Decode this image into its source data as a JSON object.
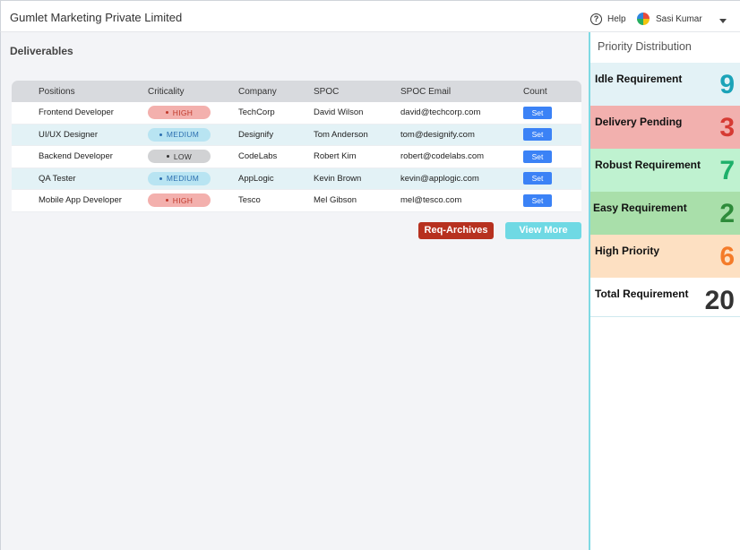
{
  "header": {
    "app_title": "Gumlet Marketing Private Limited",
    "help_label": "Help",
    "user_name": "Sasi Kumar"
  },
  "main": {
    "section_title": "Deliverables",
    "columns": [
      "Positions",
      "Criticality",
      "Company",
      "SPOC",
      "SPOC Email",
      "Count"
    ],
    "rows": [
      {
        "position": "Frontend Developer",
        "criticality": "HIGH",
        "company": "TechCorp",
        "spoc": "David Wilson",
        "email": "david@techcorp.com",
        "action": "Set"
      },
      {
        "position": "UI/UX Designer",
        "criticality": "MEDIUM",
        "company": "Designify",
        "spoc": "Tom Anderson",
        "email": "tom@designify.com",
        "action": "Set"
      },
      {
        "position": "Backend Developer",
        "criticality": "LOW",
        "company": "CodeLabs",
        "spoc": "Robert Kim",
        "email": "robert@codelabs.com",
        "action": "Set"
      },
      {
        "position": "QA Tester",
        "criticality": "MEDIUM",
        "company": "AppLogic",
        "spoc": "Kevin Brown",
        "email": "kevin@applogic.com",
        "action": "Set"
      },
      {
        "position": "Mobile App Developer",
        "criticality": "HIGH",
        "company": "Tesco",
        "spoc": "Mel Gibson",
        "email": "mel@tesco.com",
        "action": "Set"
      }
    ],
    "archive_label": "Req-Archives",
    "view_more_label": "View More"
  },
  "priority": {
    "title": "Priority Distribution",
    "cards": [
      {
        "label": "Idle Requirement",
        "value": "9",
        "bg": "#e3f2f6",
        "color": "#1ba3b8"
      },
      {
        "label": "Delivery Pending",
        "value": "3",
        "bg": "#f2b0ae",
        "color": "#d63a33"
      },
      {
        "label": "Robust Requirement",
        "value": "7",
        "bg": "#bff2d0",
        "color": "#1db06a"
      },
      {
        "label": "Easy Requirement",
        "value": "2",
        "bg": "#a9dfaa",
        "color": "#2e8b3a"
      },
      {
        "label": "High Priority",
        "value": "6",
        "bg": "#fde0c2",
        "color": "#f47b29"
      },
      {
        "label": "Total Requirement",
        "value": "20",
        "bg": "#ffffff",
        "color": "#333333"
      }
    ]
  }
}
